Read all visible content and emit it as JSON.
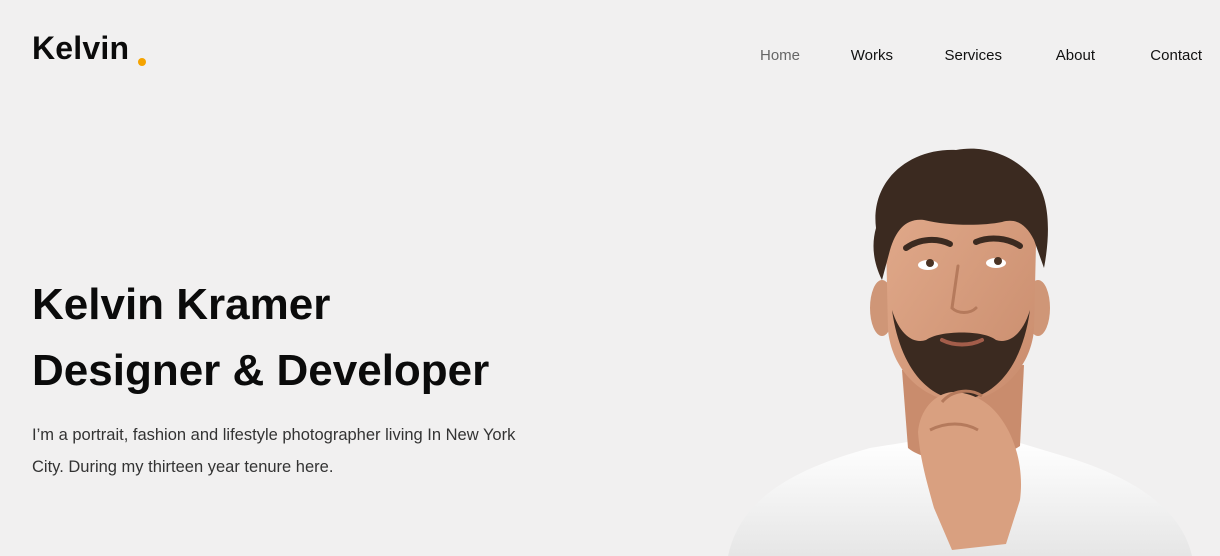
{
  "brand": {
    "name": "Kelvin",
    "dot_color": "#f5a300"
  },
  "nav": {
    "items": [
      {
        "label": "Home",
        "active": true
      },
      {
        "label": "Works",
        "active": false
      },
      {
        "label": "Services",
        "active": false
      },
      {
        "label": "About",
        "active": false
      },
      {
        "label": "Contact",
        "active": false
      }
    ]
  },
  "hero": {
    "title_line1": "Kelvin Kramer",
    "title_line2": "Designer & Developer",
    "description": "I’m a portrait, fashion and lifestyle photographer living In New York City. During my thirteen year tenure here."
  },
  "colors": {
    "background": "#f1f0f0",
    "text": "#0b0b0b",
    "accent": "#f5a300"
  }
}
